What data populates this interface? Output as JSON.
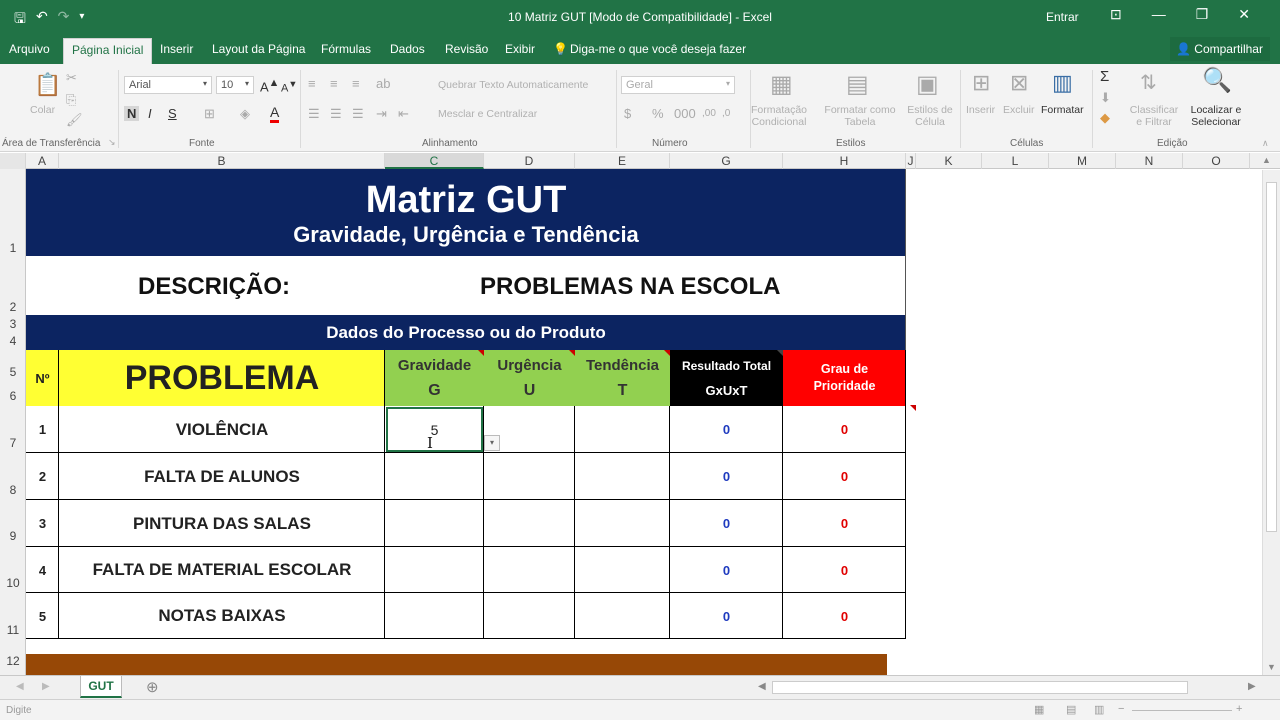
{
  "window": {
    "title": "10 Matriz GUT  [Modo de Compatibilidade]  -  Excel",
    "signin": "Entrar"
  },
  "tabs": [
    "Arquivo",
    "Página Inicial",
    "Inserir",
    "Layout da Página",
    "Fórmulas",
    "Dados",
    "Revisão",
    "Exibir"
  ],
  "tell_me": "Diga-me o que você deseja fazer",
  "share": "Compartilhar",
  "ribbon": {
    "clipboard": {
      "paste": "Colar",
      "label": "Área de Transferência"
    },
    "font": {
      "name": "Arial",
      "size": "10",
      "bold": "N",
      "italic": "I",
      "underline": "S",
      "label": "Fonte"
    },
    "alignment": {
      "wrap": "Quebrar Texto Automaticamente",
      "merge": "Mesclar e Centralizar",
      "label": "Alinhamento"
    },
    "number": {
      "format": "Geral",
      "label": "Número"
    },
    "styles": {
      "conditional": "Formatação Condicional",
      "as_table": "Formatar como Tabela",
      "cell_styles": "Estilos de Célula",
      "label": "Estilos"
    },
    "cells": {
      "insert": "Inserir",
      "delete": "Excluir",
      "format": "Formatar",
      "label": "Células"
    },
    "editing": {
      "sort": "Classificar e Filtrar",
      "find": "Localizar e Selecionar",
      "label": "Edição"
    }
  },
  "columns": [
    "A",
    "B",
    "C",
    "D",
    "E",
    "G",
    "H",
    "J",
    "K",
    "L",
    "M",
    "N",
    "O"
  ],
  "rows": [
    "1",
    "2",
    "3",
    "4",
    "5",
    "6",
    "7",
    "8",
    "9",
    "10",
    "11",
    "12"
  ],
  "sheet": {
    "title": "Matriz GUT",
    "subtitle": "Gravidade, Urgência e Tendência",
    "description_label": "DESCRIÇÃO:",
    "description_value": "PROBLEMAS NA ESCOLA",
    "section": "Dados do Processo ou do Produto",
    "headers": {
      "num": "Nº",
      "problem": "PROBLEMA",
      "g": "Gravidade",
      "g_letter": "G",
      "u": "Urgência",
      "u_letter": "U",
      "t": "Tendência",
      "t_letter": "T",
      "total": "Resultado Total",
      "total_formula": "GxUxT",
      "priority": "Grau de Prioridade"
    },
    "items": [
      {
        "n": "1",
        "problem": "VIOLÊNCIA",
        "g": "5",
        "u": "",
        "t": "",
        "total": "0",
        "priority": "0"
      },
      {
        "n": "2",
        "problem": "FALTA DE ALUNOS",
        "g": "",
        "u": "",
        "t": "",
        "total": "0",
        "priority": "0"
      },
      {
        "n": "3",
        "problem": "PINTURA DAS SALAS",
        "g": "",
        "u": "",
        "t": "",
        "total": "0",
        "priority": "0"
      },
      {
        "n": "4",
        "problem": "FALTA DE MATERIAL ESCOLAR",
        "g": "",
        "u": "",
        "t": "",
        "total": "0",
        "priority": "0"
      },
      {
        "n": "5",
        "problem": "NOTAS BAIXAS",
        "g": "",
        "u": "",
        "t": "",
        "total": "0",
        "priority": "0"
      }
    ]
  },
  "sheet_tab": "GUT",
  "status": "Digite",
  "colors": {
    "excel_green": "#217346",
    "title_blue": "#0c2461",
    "yellow": "#ffff33",
    "green": "#92d050",
    "red": "#ff0000",
    "brown": "#974806",
    "blue_value": "#1f3bbf",
    "red_value": "#e00000"
  }
}
